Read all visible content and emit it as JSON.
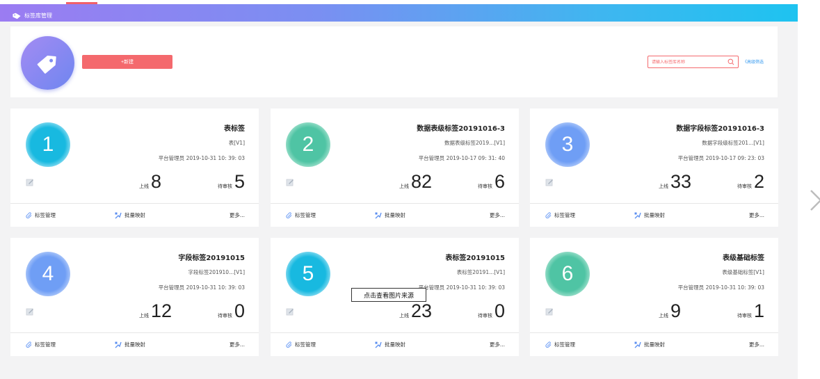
{
  "header": {
    "title": "标签库管理"
  },
  "toolbar": {
    "new_label": "+新建"
  },
  "search": {
    "placeholder": "请输入标签库名称",
    "advanced_label": "《高级筛选"
  },
  "cards": [
    {
      "num": "1",
      "color": "cyan",
      "title": "表标签",
      "sub": "表[V1]",
      "meta": "平台管理员 2019-10-31 10: 39: 03",
      "online_label": "上线",
      "online": "8",
      "pending_label": "待审核",
      "pending": "5",
      "f1": "标签管理",
      "f2": "批量映射",
      "f3": "更多..."
    },
    {
      "num": "2",
      "color": "green",
      "title": "数据表级标签20191016-3",
      "sub": "数据表级标签2019...[V1]",
      "meta": "平台管理员 2019-10-17 09: 31: 40",
      "online_label": "上线",
      "online": "82",
      "pending_label": "待审核",
      "pending": "6",
      "f1": "标签管理",
      "f2": "批量映射",
      "f3": "更多..."
    },
    {
      "num": "3",
      "color": "blue",
      "title": "数据字段标签20191016-3",
      "sub": "数据字段级标签201...[V1]",
      "meta": "平台管理员 2019-10-17 09: 23: 03",
      "online_label": "上线",
      "online": "33",
      "pending_label": "待审核",
      "pending": "2",
      "f1": "标签管理",
      "f2": "批量映射",
      "f3": "更多..."
    },
    {
      "num": "4",
      "color": "blue",
      "title": "字段标签20191015",
      "sub": "字段标签201910...[V1]",
      "meta": "平台管理员 2019-10-31 10: 39: 03",
      "online_label": "上线",
      "online": "12",
      "pending_label": "待审核",
      "pending": "0",
      "f1": "标签管理",
      "f2": "批量映射",
      "f3": "更多..."
    },
    {
      "num": "5",
      "color": "cyan",
      "title": "表标签20191015",
      "sub": "表标签20191...[V1]",
      "meta": "平台管理员 2019-10-31 10: 39: 03",
      "online_label": "上线",
      "online": "23",
      "pending_label": "待审核",
      "pending": "0",
      "f1": "标签管理",
      "f2": "批量映射",
      "f3": "更多..."
    },
    {
      "num": "6",
      "color": "green",
      "title": "表级基础标签",
      "sub": "表级基础标签[V1]",
      "meta": "平台管理员 2019-10-31 10: 39: 03",
      "online_label": "上线",
      "online": "9",
      "pending_label": "待审核",
      "pending": "1",
      "f1": "标签管理",
      "f2": "批量映射",
      "f3": "更多..."
    }
  ],
  "tooltip": {
    "text": "点击查看图片来源"
  },
  "icons": {
    "header": "tag-icon",
    "big": "tag-icon",
    "edit": "edit-icon",
    "f1": "paperclip-icon",
    "f2": "mapping-icon",
    "next": "chevron-right-icon"
  },
  "colors": {
    "accent": "#f4696d",
    "cyan": "#18b9e0",
    "green": "#4fc4a4",
    "blue": "#6f9ef5",
    "link": "#3a9cf0"
  }
}
